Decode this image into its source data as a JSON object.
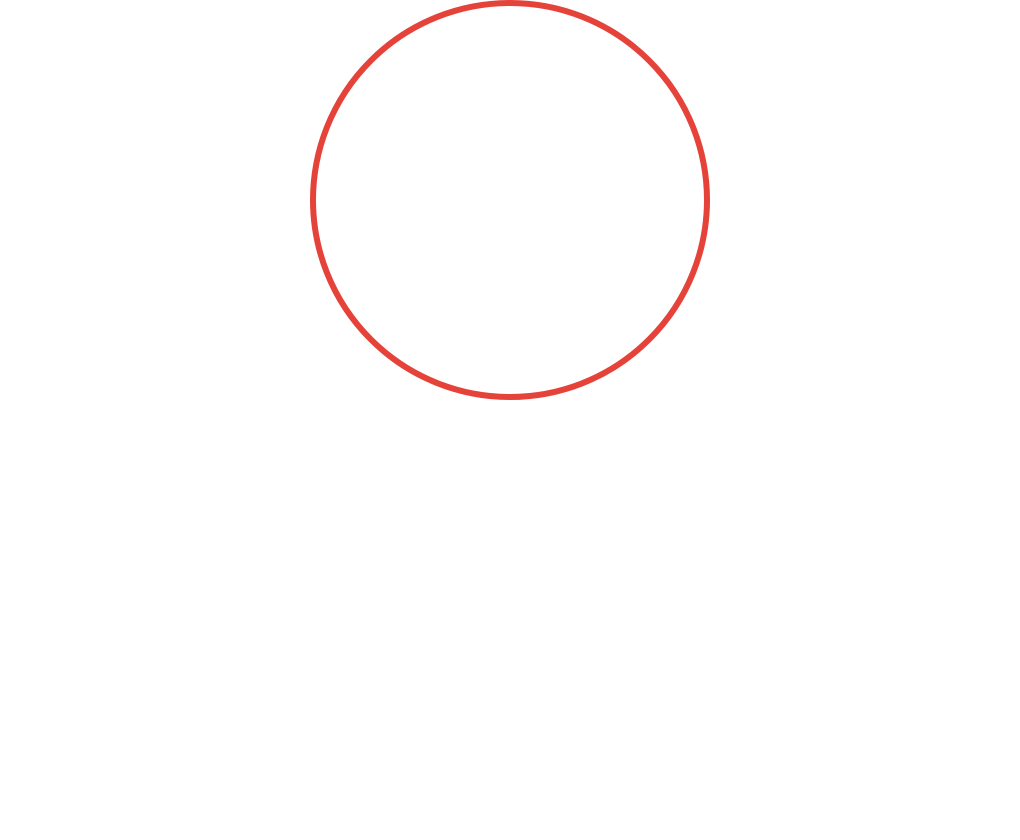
{
  "canvas": {
    "background_color": "#ffffff"
  },
  "shapes": [
    {
      "kind": "circle-outline",
      "stroke_color": "#e5433a",
      "fill": "none"
    }
  ]
}
